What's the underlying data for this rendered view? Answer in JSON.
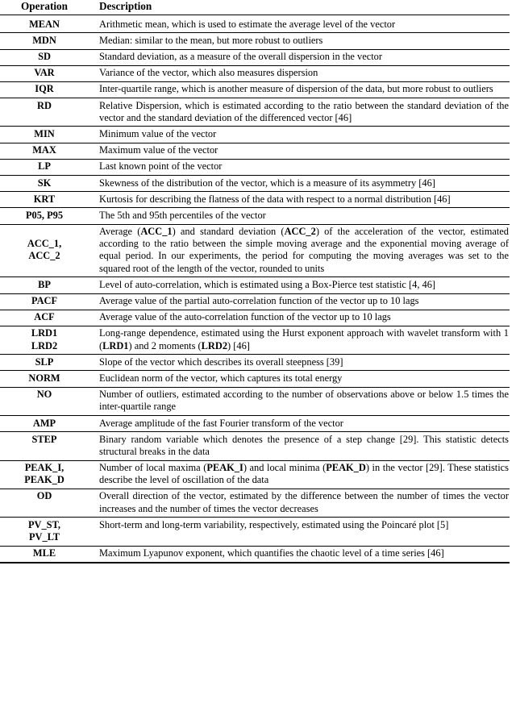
{
  "table": {
    "headers": {
      "operation": "Operation",
      "description": "Description"
    },
    "rows": [
      {
        "operation": "MEAN",
        "description": "Arithmetic mean, which is used to estimate the average level of the vector",
        "justify": false
      },
      {
        "operation": "MDN",
        "description": "Median: similar to the mean, but more robust to outliers",
        "justify": false
      },
      {
        "operation": "SD",
        "description": "Standard deviation, as a measure of the overall dispersion in the vector",
        "justify": false
      },
      {
        "operation": "VAR",
        "description": "Variance of the vector, which also measures dispersion",
        "justify": false
      },
      {
        "operation": "IQR",
        "description": "Inter-quartile range, which is another measure of dispersion of the data, but more robust to outliers",
        "justify": true
      },
      {
        "operation": "RD",
        "description": "Relative Dispersion, which is estimated according to the ratio between the standard deviation of the vector and the standard deviation of the differenced vector [46]",
        "justify": true
      },
      {
        "operation": "MIN",
        "description": "Minimum value of the vector",
        "justify": false
      },
      {
        "operation": "MAX",
        "description": "Maximum value of the vector",
        "justify": false
      },
      {
        "operation": "LP",
        "description": "Last known point of the vector",
        "justify": false
      },
      {
        "operation": "SK",
        "description": "Skewness of the distribution of the vector, which is a measure of its asymmetry [46]",
        "justify": true
      },
      {
        "operation": "KRT",
        "description": "Kurtosis for describing the flatness of the data with respect to a normal distribution [46]",
        "justify": true
      },
      {
        "operation": "P05, P95",
        "description": "The 5th and 95th percentiles of the vector",
        "justify": false
      },
      {
        "operation": "ACC_1,\nACC_2",
        "description": "Average (ACC_1) and standard deviation (ACC_2) of the acceleration of the vector, estimated according to the ratio between the simple moving average and the exponential moving average of equal period. In our experiments, the period for computing the moving averages was set to the squared root of the length of the vector, rounded to units",
        "justify": true,
        "op_middle": true,
        "emphasis": [
          "ACC_1",
          "ACC_2"
        ]
      },
      {
        "operation": "BP",
        "description": "Level of auto-correlation, which is estimated using a Box-Pierce test statistic [4, 46]",
        "justify": true
      },
      {
        "operation": "PACF",
        "description": "Average value of the partial auto-correlation function of the vector up to 10 lags",
        "justify": true
      },
      {
        "operation": "ACF",
        "description": "Average value of the auto-correlation function of the vector up to 10 lags",
        "justify": false
      },
      {
        "operation": "LRD1\nLRD2",
        "description": "Long-range dependence, estimated using the Hurst exponent approach with wavelet transform with 1 (LRD1) and 2 moments (LRD2) [46]",
        "justify": true,
        "op_middle": true,
        "emphasis": [
          "LRD1",
          "LRD2"
        ]
      },
      {
        "operation": "SLP",
        "description": "Slope of the vector which describes its overall steepness [39]",
        "justify": false
      },
      {
        "operation": "NORM",
        "description": "Euclidean norm of the vector, which captures its total energy",
        "justify": false
      },
      {
        "operation": "NO",
        "description": "Number of outliers, estimated according to the number of observations above or below 1.5 times the inter-quartile range",
        "justify": true
      },
      {
        "operation": "AMP",
        "description": "Average amplitude of the fast Fourier transform of the vector",
        "justify": false
      },
      {
        "operation": "STEP",
        "description": "Binary random variable which denotes the presence of a step change [29]. This statistic detects structural breaks in the data",
        "justify": true
      },
      {
        "operation": "PEAK_I,\nPEAK_D",
        "description": "Number of local maxima (PEAK_I) and local minima (PEAK_D) in the vector [29]. These statistics describe the level of oscillation of the data",
        "justify": true,
        "op_middle": true,
        "emphasis": [
          "PEAK_I",
          "PEAK_D"
        ]
      },
      {
        "operation": "OD",
        "description": "Overall direction of the vector, estimated by the difference between the number of times the vector increases and the number of times the vector decreases",
        "justify": true
      },
      {
        "operation": "PV_ST,\nPV_LT",
        "description": "Short-term and long-term variability, respectively, estimated using the Poincaré plot [5]",
        "justify": true,
        "op_middle": true
      },
      {
        "operation": "MLE",
        "description": "Maximum Lyapunov exponent, which quantifies the chaotic level of a time series [46]",
        "justify": true
      }
    ]
  }
}
